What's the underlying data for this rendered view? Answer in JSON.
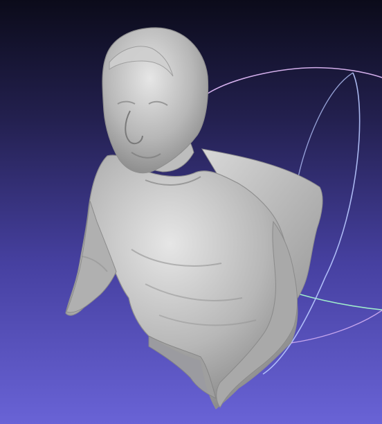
{
  "app": {
    "viewport_label": "",
    "model_name": "",
    "colors": {
      "background_top": "#0b0b1a",
      "background_bottom": "#6963d6",
      "mesh": "#bdbdbd",
      "trackball_x": "#b8c8ff",
      "trackball_y": "#a9ffcf",
      "trackball_z": "#e8c0ff"
    },
    "icons": {
      "trackball": "trackball-icon",
      "mesh": "mesh-icon"
    }
  }
}
